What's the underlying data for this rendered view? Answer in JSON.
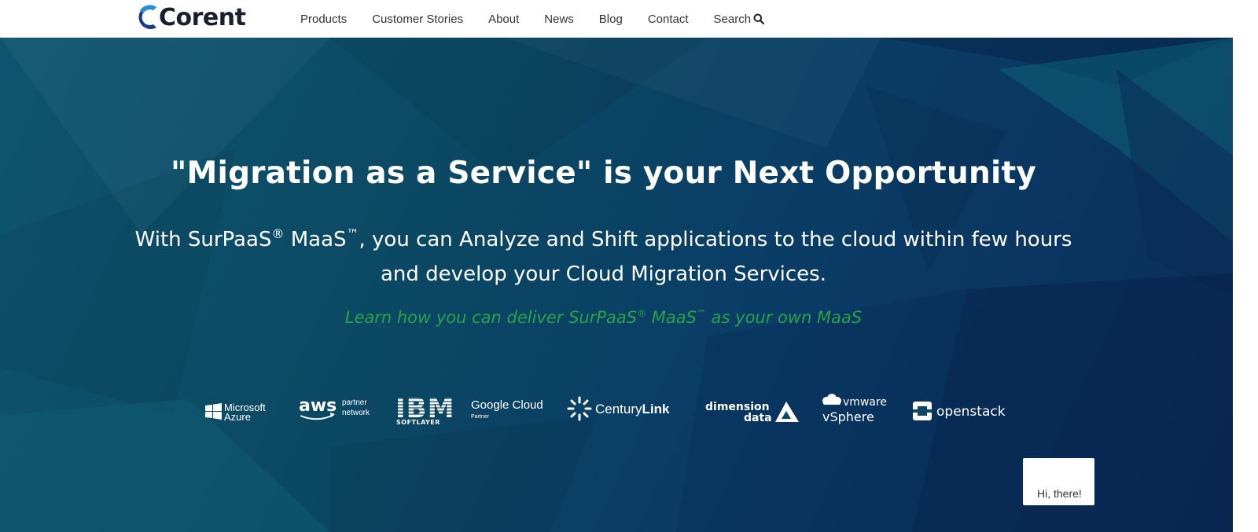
{
  "brand": {
    "name": "Corent",
    "color": "#1b3a8c"
  },
  "nav": {
    "items": [
      {
        "label": "Products"
      },
      {
        "label": "Customer Stories"
      },
      {
        "label": "About"
      },
      {
        "label": "News"
      },
      {
        "label": "Blog"
      },
      {
        "label": "Contact"
      }
    ],
    "search_label": "Search",
    "search_icon": "search-icon"
  },
  "hero": {
    "headline": "\"Migration as a Service\" is your Next Opportunity",
    "sub": {
      "part1": "With SurPaaS",
      "reg": "®",
      "part2": " MaaS",
      "tm": "™",
      "part3": ", you can Analyze and Shift applications to the cloud within few hours and develop your Cloud Migration Services."
    },
    "cta": {
      "part1": "Learn how you can deliver SurPaaS",
      "reg": "®",
      "part2": " MaaS",
      "tm": "™",
      "part3": " as your own MaaS"
    },
    "cta_color": "#29a34a"
  },
  "partners": {
    "azure": {
      "line1": "Microsoft",
      "line2": "Azure"
    },
    "aws": {
      "name": "aws",
      "line1": "partner",
      "line2": "network"
    },
    "ibm": {
      "name": "IBM",
      "sub": "SOFTLAYER"
    },
    "google": {
      "name": "Google Cloud",
      "sub": "Partner"
    },
    "centurylink": {
      "name1": "Century",
      "name2": "Link"
    },
    "dimension": {
      "line1": "dimension",
      "line2": "data"
    },
    "vmware": {
      "line1": "vmware",
      "line2": "vSphere"
    },
    "openstack": {
      "name": "openstack"
    }
  },
  "chat": {
    "text": "Hi, there!"
  }
}
